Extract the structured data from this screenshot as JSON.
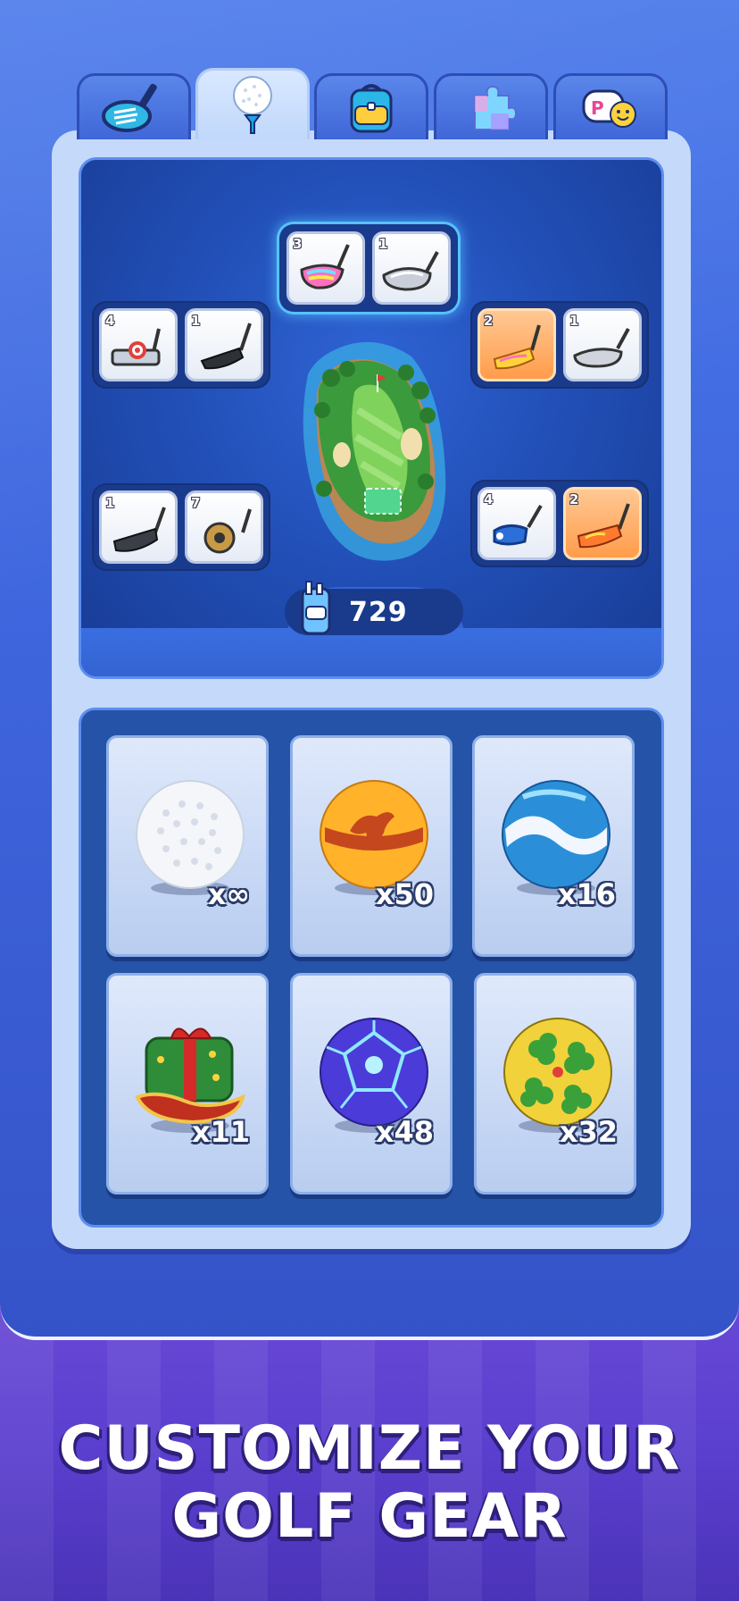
{
  "tabs": [
    {
      "name": "clubs",
      "icon": "golf-club-icon"
    },
    {
      "name": "balls",
      "icon": "golf-ball-icon",
      "active": true
    },
    {
      "name": "bags",
      "icon": "backpack-icon"
    },
    {
      "name": "puzzles",
      "icon": "puzzle-icon"
    },
    {
      "name": "emotes",
      "icon": "emote-icon"
    }
  ],
  "bag": {
    "slots": {
      "top_center": [
        {
          "level": "3"
        },
        {
          "level": "1"
        }
      ],
      "mid_left": [
        {
          "level": "4"
        },
        {
          "level": "1"
        }
      ],
      "mid_right": [
        {
          "level": "2"
        },
        {
          "level": "1"
        }
      ],
      "low_left": [
        {
          "level": "1"
        },
        {
          "level": "7"
        }
      ],
      "low_right": [
        {
          "level": "4"
        },
        {
          "level": "2"
        }
      ]
    },
    "total_value": "729"
  },
  "balls": [
    {
      "count": "x∞",
      "style": "white"
    },
    {
      "count": "x50",
      "style": "kangaroo"
    },
    {
      "count": "x16",
      "style": "blue-wave"
    },
    {
      "count": "x11",
      "style": "gift-sleigh"
    },
    {
      "count": "x48",
      "style": "electric-purple"
    },
    {
      "count": "x32",
      "style": "clover"
    }
  ],
  "headline": {
    "line1": "CUSTOMIZE YOUR",
    "line2": "GOLF GEAR"
  }
}
